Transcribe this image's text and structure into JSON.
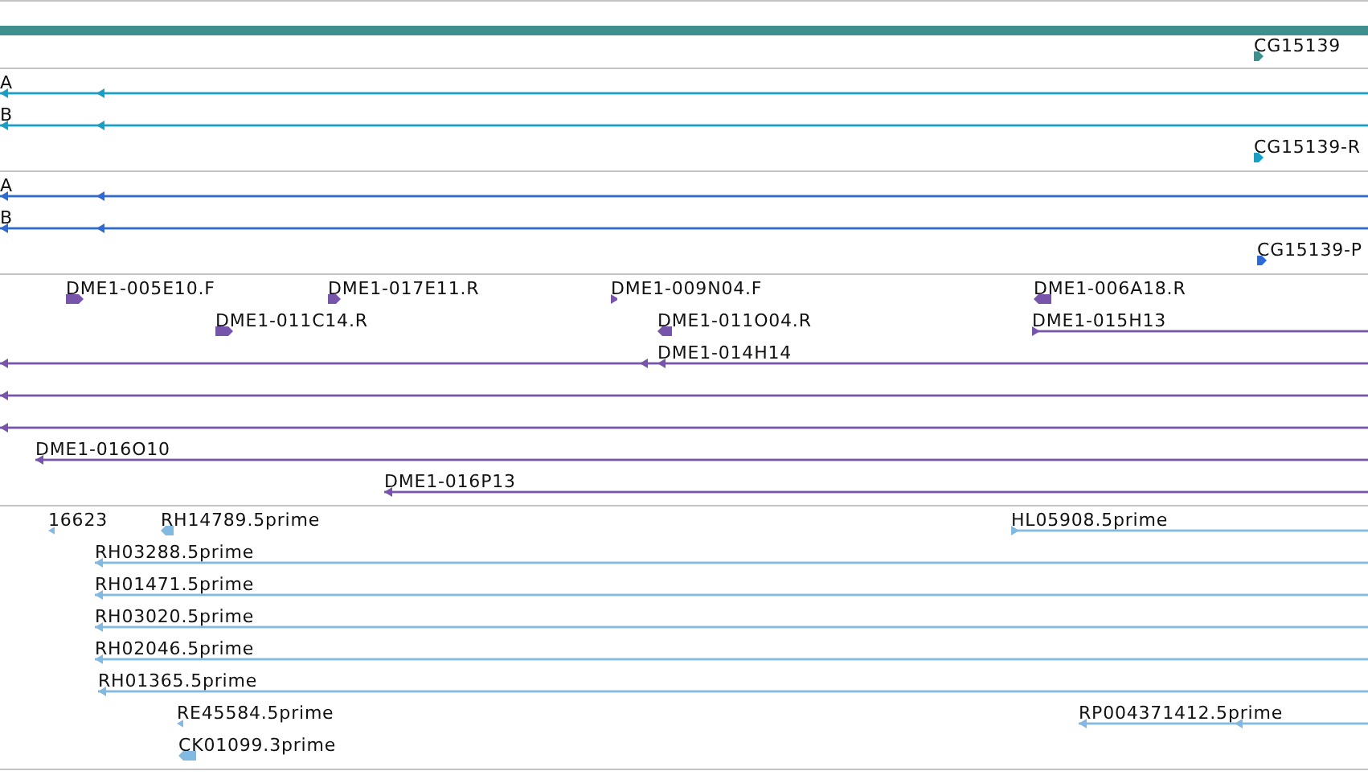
{
  "tracks": [
    {
      "color": "#3f8f8f",
      "rows": [
        {
          "features": [
            {
              "label": "CG15139",
              "kind": "block",
              "forward": true
            }
          ]
        }
      ]
    },
    {
      "color": "#1a9fc4",
      "rows": [
        {
          "features": [
            {
              "label": "A",
              "kind": "span",
              "forward": false
            }
          ]
        },
        {
          "features": [
            {
              "label": "B",
              "kind": "span",
              "forward": false
            }
          ]
        },
        {
          "features": [
            {
              "label": "CG15139-R",
              "kind": "block",
              "forward": true
            }
          ]
        }
      ]
    },
    {
      "color": "#2f6ad0",
      "rows": [
        {
          "features": [
            {
              "label": "A",
              "kind": "span",
              "forward": false
            }
          ]
        },
        {
          "features": [
            {
              "label": "B",
              "kind": "span",
              "forward": false
            }
          ]
        },
        {
          "features": [
            {
              "label": "CG15139-P",
              "kind": "block",
              "forward": true
            }
          ]
        }
      ]
    },
    {
      "color": "#7755aa",
      "rows": [
        {
          "features": [
            {
              "label": "DME1-005E10.F",
              "kind": "block",
              "forward": true
            },
            {
              "label": "DME1-017E11.R",
              "kind": "block",
              "forward": true
            },
            {
              "label": "DME1-009N04.F",
              "kind": "block",
              "forward": true
            },
            {
              "label": "DME1-006A18.R",
              "kind": "block",
              "forward": false
            }
          ]
        },
        {
          "features": [
            {
              "label": "DME1-011C14.R",
              "kind": "block",
              "forward": true
            },
            {
              "label": "DME1-011O04.R",
              "kind": "block",
              "forward": false
            },
            {
              "label": "DME1-015H13",
              "kind": "span",
              "forward": true
            }
          ]
        },
        {
          "features": [
            {
              "label": "DME1-014H14",
              "kind": "span",
              "forward": false
            }
          ]
        },
        {
          "features": [
            {
              "kind": "span",
              "forward": false
            }
          ]
        },
        {
          "features": [
            {
              "kind": "span",
              "forward": false
            }
          ]
        },
        {
          "features": [
            {
              "label": "DME1-016O10",
              "kind": "span",
              "forward": false
            }
          ]
        },
        {
          "features": [
            {
              "label": "DME1-016P13",
              "kind": "span",
              "forward": false
            }
          ]
        }
      ]
    },
    {
      "color": "#82b9e0",
      "rows": [
        {
          "features": [
            {
              "label": "16623",
              "kind": "block",
              "forward": false
            },
            {
              "label": "RH14789.5prime",
              "kind": "block",
              "forward": false
            },
            {
              "label": "HL05908.5prime",
              "kind": "span",
              "forward": true
            }
          ]
        },
        {
          "features": [
            {
              "label": "RH03288.5prime",
              "kind": "span",
              "forward": false
            }
          ]
        },
        {
          "features": [
            {
              "label": "RH01471.5prime",
              "kind": "span",
              "forward": false
            }
          ]
        },
        {
          "features": [
            {
              "label": "RH03020.5prime",
              "kind": "span",
              "forward": false
            }
          ]
        },
        {
          "features": [
            {
              "label": "RH02046.5prime",
              "kind": "span",
              "forward": false
            }
          ]
        },
        {
          "features": [
            {
              "label": "RH01365.5prime",
              "kind": "span",
              "forward": false
            }
          ]
        },
        {
          "features": [
            {
              "label": "RE45584.5prime",
              "kind": "block",
              "forward": false
            },
            {
              "label": "RP004371412.5prime",
              "kind": "span",
              "forward": false
            }
          ]
        },
        {
          "features": [
            {
              "label": "CK01099.3prime",
              "kind": "block",
              "forward": false
            }
          ]
        }
      ]
    }
  ]
}
